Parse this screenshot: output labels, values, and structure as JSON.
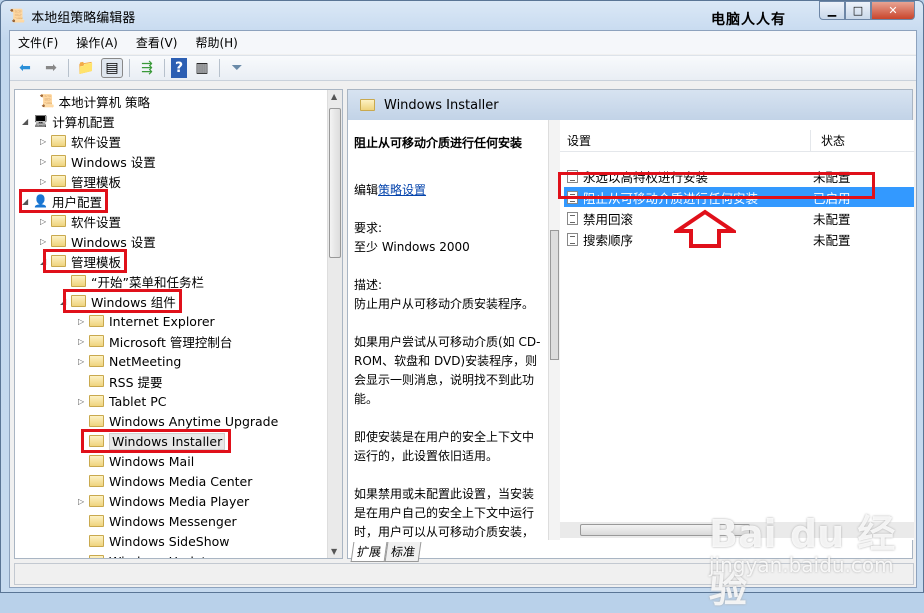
{
  "window": {
    "title": "本地组策略编辑器",
    "watermark_top": "电脑人人有",
    "controls": [
      "minimize",
      "maximize",
      "close"
    ]
  },
  "menu": [
    "文件(F)",
    "操作(A)",
    "查看(V)",
    "帮助(H)"
  ],
  "toolbar": [
    "back-icon",
    "forward-icon",
    "up-folder-icon",
    "show-hide-tree-icon",
    "export-list-icon",
    "help-icon",
    "show-action-pane-icon",
    "filter-icon"
  ],
  "tree": [
    {
      "label": "本地计算机 策略",
      "level": 0,
      "expander": "none"
    },
    {
      "label": "计算机配置",
      "level": 1,
      "expander": "expanded"
    },
    {
      "label": "软件设置",
      "level": 2,
      "expander": "collapsed"
    },
    {
      "label": "Windows 设置",
      "level": 2,
      "expander": "collapsed"
    },
    {
      "label": "管理模板",
      "level": 2,
      "expander": "collapsed"
    },
    {
      "label": "用户配置",
      "level": 1,
      "expander": "expanded",
      "highlight": true
    },
    {
      "label": "软件设置",
      "level": 2,
      "expander": "collapsed"
    },
    {
      "label": "Windows 设置",
      "level": 2,
      "expander": "collapsed"
    },
    {
      "label": "管理模板",
      "level": 2,
      "expander": "expanded",
      "highlight": true
    },
    {
      "label": "“开始”菜单和任务栏",
      "level": 3,
      "expander": "none"
    },
    {
      "label": "Windows 组件",
      "level": 3,
      "expander": "expanded",
      "highlight": true
    },
    {
      "label": "Internet Explorer",
      "level": 4,
      "expander": "collapsed"
    },
    {
      "label": "Microsoft 管理控制台",
      "level": 4,
      "expander": "collapsed"
    },
    {
      "label": "NetMeeting",
      "level": 4,
      "expander": "collapsed"
    },
    {
      "label": "RSS 提要",
      "level": 4,
      "expander": "none"
    },
    {
      "label": "Tablet PC",
      "level": 4,
      "expander": "collapsed"
    },
    {
      "label": "Windows Anytime Upgrade",
      "level": 4,
      "expander": "none"
    },
    {
      "label": "Windows Installer",
      "level": 4,
      "expander": "none",
      "highlight": true,
      "selected": true
    },
    {
      "label": "Windows Mail",
      "level": 4,
      "expander": "none"
    },
    {
      "label": "Windows Media Center",
      "level": 4,
      "expander": "none"
    },
    {
      "label": "Windows Media Player",
      "level": 4,
      "expander": "collapsed"
    },
    {
      "label": "Windows Messenger",
      "level": 4,
      "expander": "none"
    },
    {
      "label": "Windows SideShow",
      "level": 4,
      "expander": "none"
    },
    {
      "label": "Windows Update",
      "level": 4,
      "expander": "none"
    }
  ],
  "right": {
    "header": "Windows Installer",
    "desc": {
      "title": "阻止从可移动介质进行任何安装",
      "edit_prefix": "编辑",
      "edit_link": "策略设置",
      "req_label": "要求:",
      "req_value": "至少 Windows 2000",
      "desc_label": "描述:",
      "desc_value": "防止用户从可移动介质安装程序。",
      "p1": "如果用户尝试从可移动介质(如 CD-ROM、软盘和 DVD)安装程序，则会显示一则消息，说明找不到此功能。",
      "p2": "即使安装是在用户的安全上下文中运行的，此设置依旧适用。",
      "p3": "如果禁用或未配置此设置，当安装是在用户自己的安全上下文中运行时，用户可以从可移动介质安装，"
    },
    "columns": [
      "设置",
      "状态"
    ],
    "rows": [
      {
        "name": "永远以高特权进行安装",
        "state": "未配置"
      },
      {
        "name": "阻止从可移动介质进行任何安装",
        "state": "已启用",
        "selected": true,
        "highlight": true
      },
      {
        "name": "禁用回滚",
        "state": "未配置"
      },
      {
        "name": "搜索顺序",
        "state": "未配置"
      }
    ],
    "tabs": [
      "扩展",
      "标准"
    ]
  },
  "annotation_color": "#e0101a",
  "logo_watermark": {
    "text": "Baidu经验",
    "url_text": "jingyan.baidu.com"
  }
}
